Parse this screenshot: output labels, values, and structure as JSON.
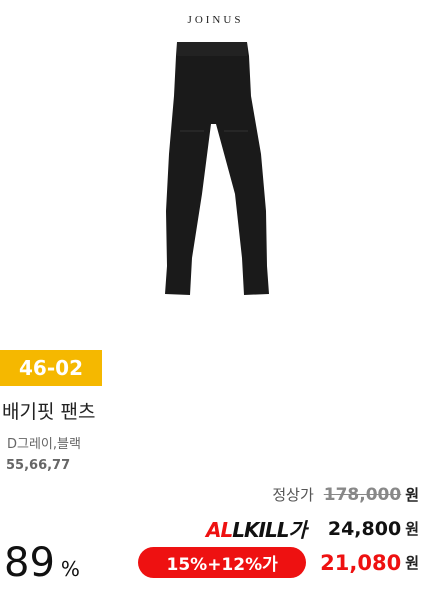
{
  "brand": "JOINUS",
  "product": {
    "code": "46-02",
    "title": "배기핏 팬츠",
    "colors": "D그레이,블랙",
    "sizes": "55,66,77"
  },
  "pricing": {
    "regular_label": "정상가",
    "regular_price": "178,000",
    "currency": "원",
    "allkill_logo_red": "AL",
    "allkill_logo_black": "LKILL가",
    "allkill_price": "24,800",
    "coupon_label": "15%+12%가",
    "final_price": "21,080"
  },
  "discount": {
    "value": "89",
    "symbol": "%"
  },
  "colors": {
    "badge": "#f5b800",
    "accent_red": "#ee1111"
  },
  "icons": [
    "product-image"
  ]
}
